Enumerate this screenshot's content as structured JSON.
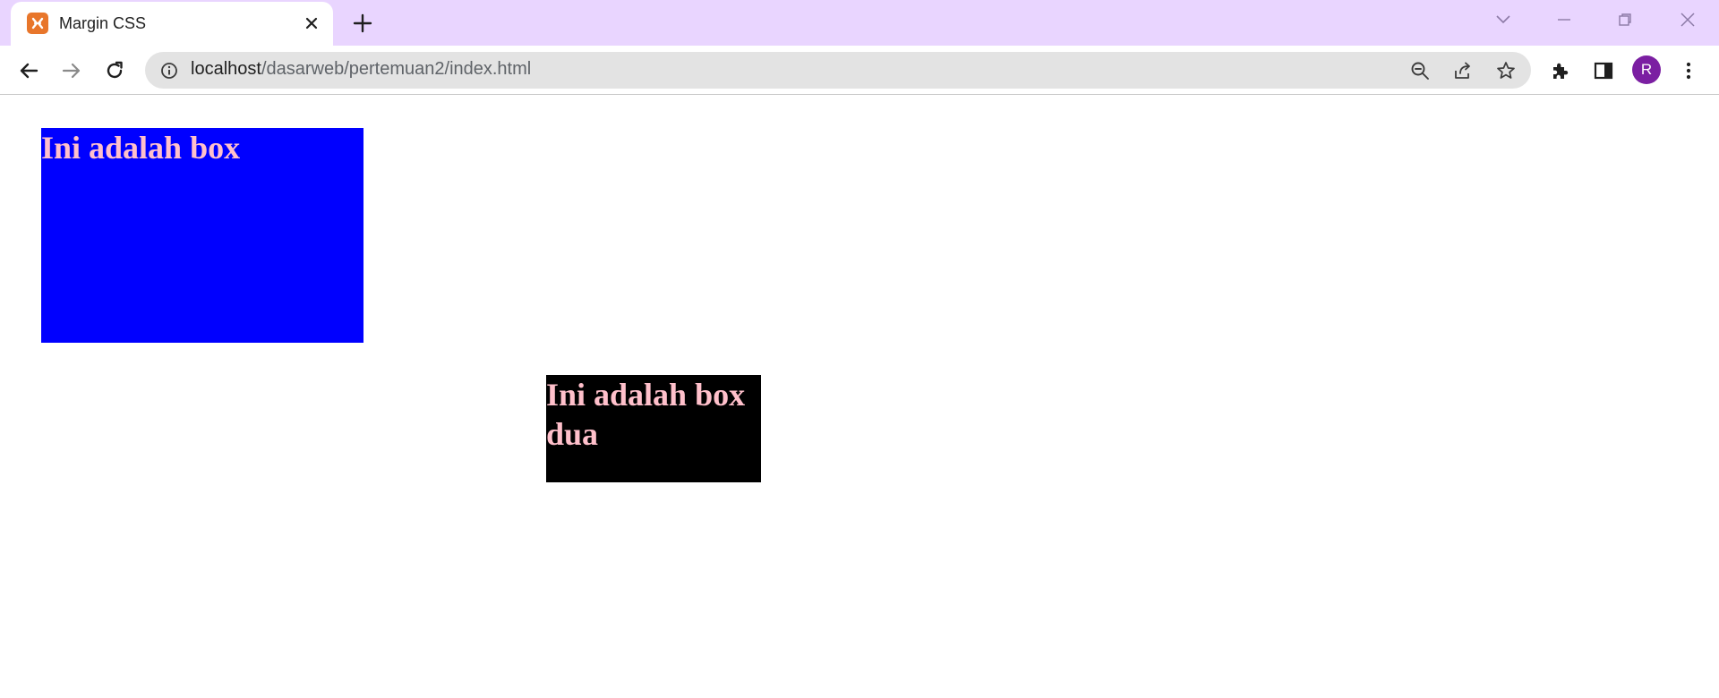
{
  "browser": {
    "tab": {
      "title": "Margin CSS",
      "favicon": "xampp-icon",
      "close_icon": "close-icon"
    },
    "new_tab_icon": "plus-icon",
    "window_controls": [
      "chevron-down-icon",
      "minimize-icon",
      "restore-icon",
      "close-icon"
    ],
    "nav": [
      "back-arrow-icon",
      "forward-arrow-icon",
      "reload-icon"
    ],
    "address": {
      "host": "localhost",
      "path": "/dasarweb/pertemuan2/index.html"
    },
    "omnibox_actions": [
      "zoom-out-icon",
      "share-icon",
      "star-icon"
    ],
    "toolbar_actions": [
      "extensions-icon",
      "side-panel-icon"
    ],
    "profile_initial": "R",
    "menu_icon": "kebab-menu-icon",
    "colors": {
      "tabstrip": "#e9d5ff",
      "omnibox": "#e3e3e3",
      "avatar": "#7b1fa2"
    }
  },
  "page": {
    "box_one": {
      "heading": "Ini adalah box",
      "background": "#0000ff",
      "text_color": "#ffc0cb"
    },
    "box_two": {
      "heading": "Ini adalah box dua",
      "background": "#000000",
      "text_color": "#ffc0cb"
    }
  }
}
